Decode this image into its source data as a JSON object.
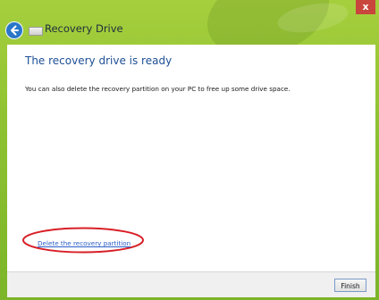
{
  "window": {
    "title": "Recovery Drive",
    "close_glyph": "x",
    "accent_color": "#8cc131"
  },
  "icons": {
    "back": "back-arrow-icon",
    "drive": "drive-icon"
  },
  "main": {
    "heading": "The recovery drive is ready",
    "description": "You can also delete the recovery partition on your PC to free up some drive space.",
    "delete_link": "Delete the recovery partition"
  },
  "footer": {
    "finish_label": "Finish"
  },
  "annotation": {
    "highlight_color": "#d81f26"
  }
}
